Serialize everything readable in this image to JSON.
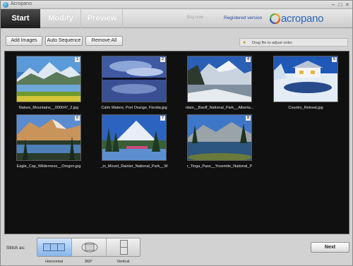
{
  "window": {
    "title": "Acropano",
    "icons": {
      "app": "app-icon",
      "minimize": "minimize-icon",
      "maximize": "maximize-icon",
      "close": "close-icon"
    }
  },
  "tabs": [
    {
      "label": "Start",
      "active": true
    },
    {
      "label": "Modify",
      "active": false
    },
    {
      "label": "Preview",
      "active": false
    }
  ],
  "header": {
    "buy_now": "Buy now",
    "registered": "Registered version",
    "logo_text": "acropano",
    "logo_icon": "acropano-logo-icon"
  },
  "toolbar": {
    "add_images": "Add Images",
    "auto_sequence": "Auto Sequence",
    "remove_all": "Remove All"
  },
  "hint": {
    "icon": "lightbulb-icon",
    "text": "Drag file to adjust order"
  },
  "images": [
    {
      "number": "1",
      "caption": "Nature_Mountains__000047_2.jpg"
    },
    {
      "number": "2",
      "caption": "Calm Waters, Port Orange, Florida.jpg"
    },
    {
      "number": "4",
      "caption": "ntain__Banff_National_Park__Alberta..."
    },
    {
      "number": "5",
      "caption": "Country_Retreat.jpg"
    },
    {
      "number": "6",
      "caption": "Eagle_Cap_Wilderness__Oregon.jpg"
    },
    {
      "number": "7",
      "caption": "_in_Mount_Rainier_National_Park__W"
    },
    {
      "number": "8",
      "caption": "r_Tioga_Pass__Yosemite_National_P"
    }
  ],
  "stitch": {
    "label": "Stitch as:",
    "options": [
      {
        "label": "Horizontal",
        "icon": "horizontal-stitch-icon",
        "selected": true
      },
      {
        "label": "360°",
        "icon": "360-stitch-icon",
        "selected": false
      },
      {
        "label": "Vertical",
        "icon": "vertical-stitch-icon",
        "selected": false
      }
    ]
  },
  "footer": {
    "next": "Next"
  },
  "colors": {
    "active_tab": "#1d1d1d",
    "gallery_bg": "#101010",
    "brand_blue": "#2a67b8",
    "registered_link": "#1f49a6",
    "selected_option": "#88b5e9"
  }
}
